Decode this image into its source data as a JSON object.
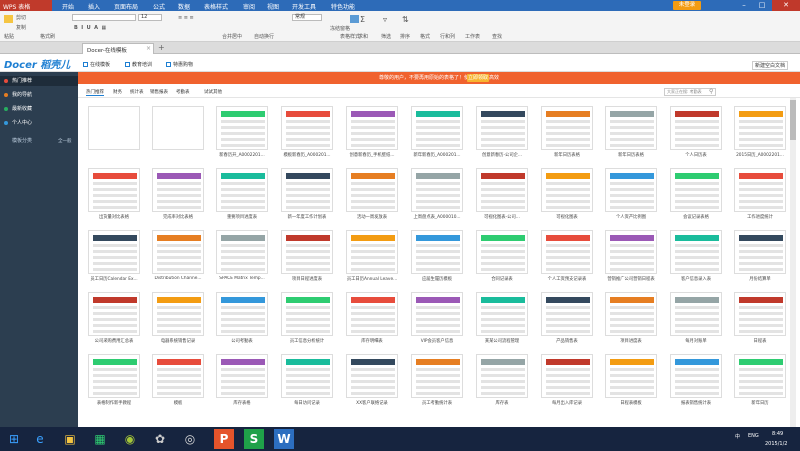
{
  "titlebar": {
    "app_name": "WPS 表格",
    "menus": [
      "开始",
      "插入",
      "页面布局",
      "公式",
      "数据",
      "表格样式",
      "审阅",
      "视图",
      "开发工具",
      "特色功能"
    ],
    "login": "未登录"
  },
  "ribbon": {
    "groups": [
      "剪切",
      "复制",
      "粘贴",
      "格式刷",
      "合并居中",
      "自动换行",
      "常规",
      "表格样式",
      "条件格式",
      "求和",
      "筛选",
      "排序",
      "格式",
      "行和列",
      "工作表",
      "查找"
    ],
    "font_size": "12",
    "extra": [
      "冻结窗格",
      "冻结首行"
    ]
  },
  "doctab": {
    "label": "Docer-在线模板"
  },
  "docer": {
    "logo": "Docer 稻壳儿",
    "tabs": [
      "在线模板",
      "教育培训",
      "特惠购物"
    ],
    "right_btn": "新建空白文档"
  },
  "sidebar": {
    "items": [
      {
        "label": "热门推荐",
        "color": "#e74c3c"
      },
      {
        "label": "我的导航",
        "color": "#e67e22"
      },
      {
        "label": "最新收藏",
        "color": "#27ae60"
      },
      {
        "label": "个人中心",
        "color": "#3498db"
      }
    ],
    "section": "模板分类",
    "section_right": "全一般"
  },
  "banner": {
    "text": "尊敬的用户，不要再用原始的表格了！使用模板更高效",
    "button": "立即领取"
  },
  "filter": {
    "tabs": [
      "热门推荐",
      "财务",
      "统计表",
      "销售报表",
      "考勤表",
      "试试其他"
    ],
    "search_placeholder": "大家正在搜: 考勤表"
  },
  "templates": [
    [
      "",
      "",
      "新春历开_A0002201...",
      "模板新春历_A000201...",
      "创意新春历_手机壁纸...",
      "新年新春历_A000201...",
      "创意新春历-公司企...",
      "新年日历表格",
      "新年日历表格",
      "个人日历表",
      "2015日历_A0002201..."
    ],
    [
      "出货量对比表格",
      "完成率对比表格",
      "重要项目进度表",
      "新一年度工作计划表",
      "活动一周发放表",
      "上周盘点表_A000010...",
      "可视化图表-公司...",
      "可视化图表",
      "个人资产比例图",
      "会议记录表格",
      "工作进度统计",
      "项目成本统计表_A0..."
    ],
    [
      "员工日历Calendar Ex...",
      "Distribution Channe...",
      "SPACE Matrix Temp...",
      "项目日程进度表",
      "员工日历Annual Leave...",
      "应届生履历模板",
      "合同记录表",
      "个人工资预支记录表",
      "营销推广公司营销日程表",
      "客户信息录入表",
      "月份结算单"
    ],
    [
      "公司采购费用汇总表",
      "电器系统销售记录",
      "公司考勤表",
      "员工信息分析统计",
      "库存明细表",
      "VIP会员客户信息",
      "某某公司流程管理",
      "产品销售表",
      "项目进度表",
      "每月对账单",
      "日程表"
    ],
    [
      "表格制作新手教程",
      "模板",
      "库存表格",
      "每日访问记录",
      "XX客户联络记录",
      "员工考勤统计表",
      "库存表",
      "每月出入库记录",
      "日程表模板",
      "报表销售统计表",
      "新年日历",
      "月份"
    ]
  ],
  "taskbar": {
    "apps": [
      "windows-logo",
      "ie",
      "explorer",
      "store",
      "android",
      "paint",
      "media",
      "wps-presentation",
      "wps-spreadsheet",
      "wps-writer"
    ],
    "time": "8:49",
    "date": "2015/1/2",
    "tray": [
      "中",
      "ENG"
    ]
  }
}
